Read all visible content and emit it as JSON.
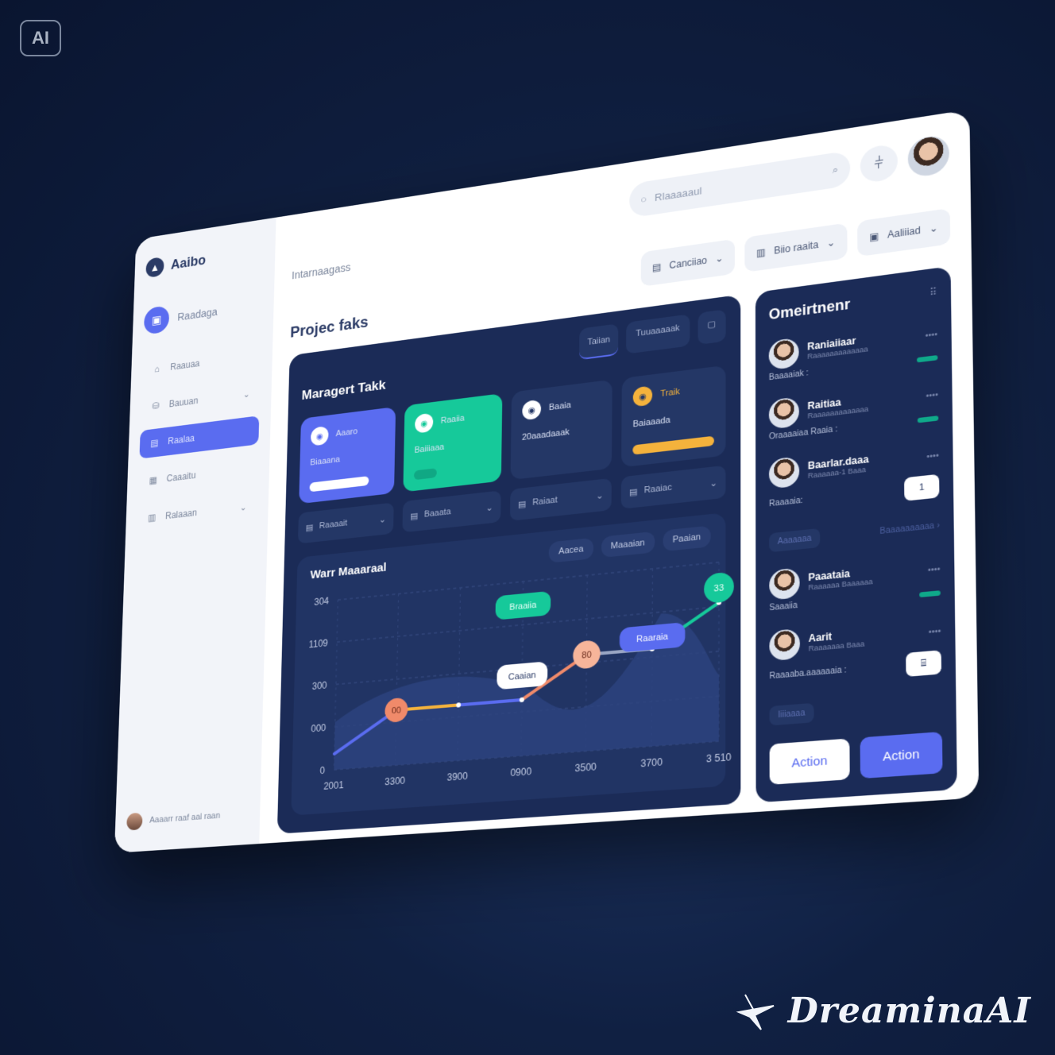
{
  "badge": "AI",
  "watermark": "DreaminaAI",
  "sidebar": {
    "brand": "Aaibo",
    "hero_label": "Raadaga",
    "items": [
      {
        "label": "Raauaa",
        "icon": "home-icon",
        "chevron": false,
        "active": false
      },
      {
        "label": "Bauuan",
        "icon": "database-icon",
        "chevron": true,
        "active": false
      },
      {
        "label": "Raalaa",
        "icon": "document-icon",
        "chevron": false,
        "active": true
      },
      {
        "label": "Caaaitu",
        "icon": "grid-icon",
        "chevron": false,
        "active": false
      },
      {
        "label": "Ralaaan",
        "icon": "calendar-icon",
        "chevron": true,
        "active": false
      }
    ],
    "user_name": "Aaaarr raaf aal raan"
  },
  "header": {
    "search_placeholder": "Rlaaaaaul",
    "breadcrumb": "Intarnaagass",
    "filters": [
      {
        "label": "Canciiao",
        "icon": "document-icon"
      },
      {
        "label": "Biio raaita",
        "icon": "calendar-icon"
      },
      {
        "label": "Aaliiiad",
        "icon": "save-icon"
      }
    ]
  },
  "main": {
    "page_title": "Projec faks",
    "panel_tabs": [
      "Taiian",
      "Tuuaaaaak"
    ],
    "section_title": "Maragert Takk",
    "cards": [
      {
        "name": "Aaaro",
        "value": "Biaaana",
        "progress": 0.8
      },
      {
        "name": "Raaiia",
        "value": "Baiiiaaa",
        "progress": 0.3
      },
      {
        "name": "Baaia",
        "value": "20aaadaaak",
        "progress": 0.0
      },
      {
        "name": "Traik",
        "value": "Baiaaada",
        "progress": 1.0
      }
    ],
    "selects": [
      "Raaaait",
      "Baaata",
      "Raiaat",
      "Raaiac"
    ]
  },
  "chart_data": {
    "type": "line",
    "title": "Warr Maaaraal",
    "pills": [
      "Aacea",
      "Maaaian",
      "Paaian"
    ],
    "y_ticks": [
      "304",
      "1109",
      "300",
      "000",
      "0"
    ],
    "x_ticks": [
      "2001",
      "3300",
      "3900",
      "0900",
      "3500",
      "3700",
      "3 510"
    ],
    "series": [
      {
        "values": [
          0,
          1,
          1,
          1,
          2,
          2,
          3
        ]
      }
    ],
    "callouts": [
      "Braaiia",
      "Caaian",
      "Raaraia",
      "33",
      "80",
      "00"
    ]
  },
  "right_panel": {
    "title": "Omeirtnenr",
    "people": [
      {
        "name": "Raniaiiaar",
        "sub": "Raaaaaaaaaaaaa",
        "meta": "Baaaaiak :",
        "extra": "tag"
      },
      {
        "name": "Raitiaa",
        "sub": "Raaaaaaaaaaaaa",
        "meta": "Oraaaaiaa Raaia :",
        "extra": "tag"
      },
      {
        "name": "Baarlar.daaa",
        "sub": "Raaaaaa-1 Baaa",
        "meta": "Raaaaia:",
        "extra": "button",
        "button_label": "1"
      },
      {
        "name": "Paaataia",
        "sub": "Raaaaaa Baaaaaa",
        "meta": "Saaaiia",
        "extra": "tag"
      },
      {
        "name": "Aarit",
        "sub": "Raaaaaaa Baaa",
        "meta": "Raaaaba.aaaaaaia :",
        "extra": "button",
        "button_label": "⌸"
      }
    ],
    "link_rows": [
      {
        "left": "Aaaaaaa",
        "right": "Baaaaaaaaaa  ›"
      },
      {
        "left": "Iiiiaaaa",
        "right": ""
      }
    ],
    "actions": [
      "Action",
      "Action"
    ]
  }
}
